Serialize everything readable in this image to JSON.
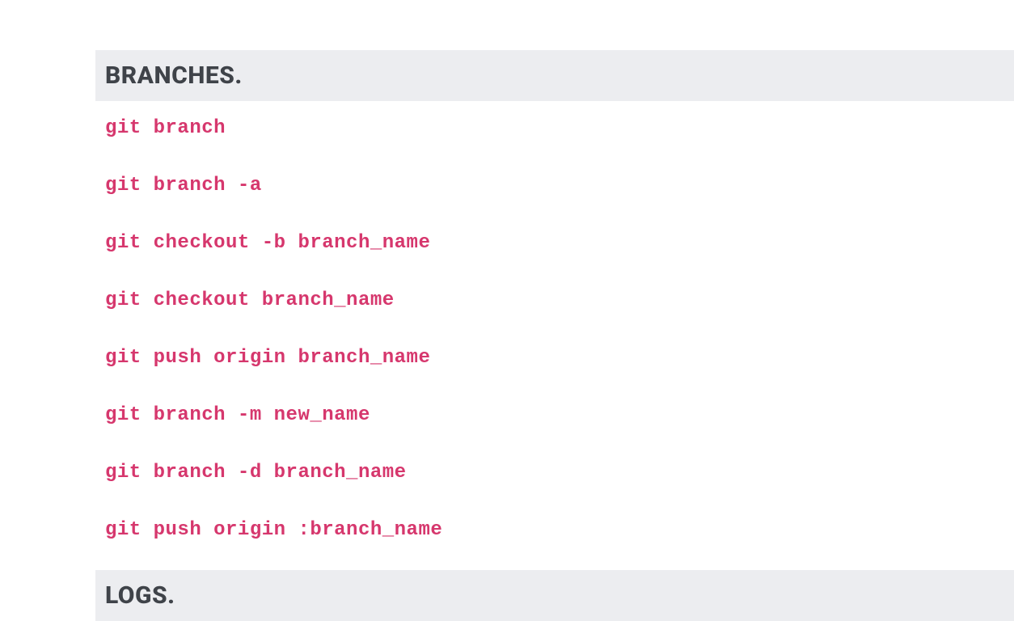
{
  "sections": [
    {
      "title": "Branches.",
      "commands": [
        "git branch",
        "git branch -a",
        "git checkout -b branch_name",
        "git checkout branch_name",
        "git push origin branch_name",
        "git branch -m new_name",
        "git branch -d branch_name",
        "git push origin :branch_name"
      ]
    },
    {
      "title": "Logs.",
      "commands": []
    }
  ]
}
